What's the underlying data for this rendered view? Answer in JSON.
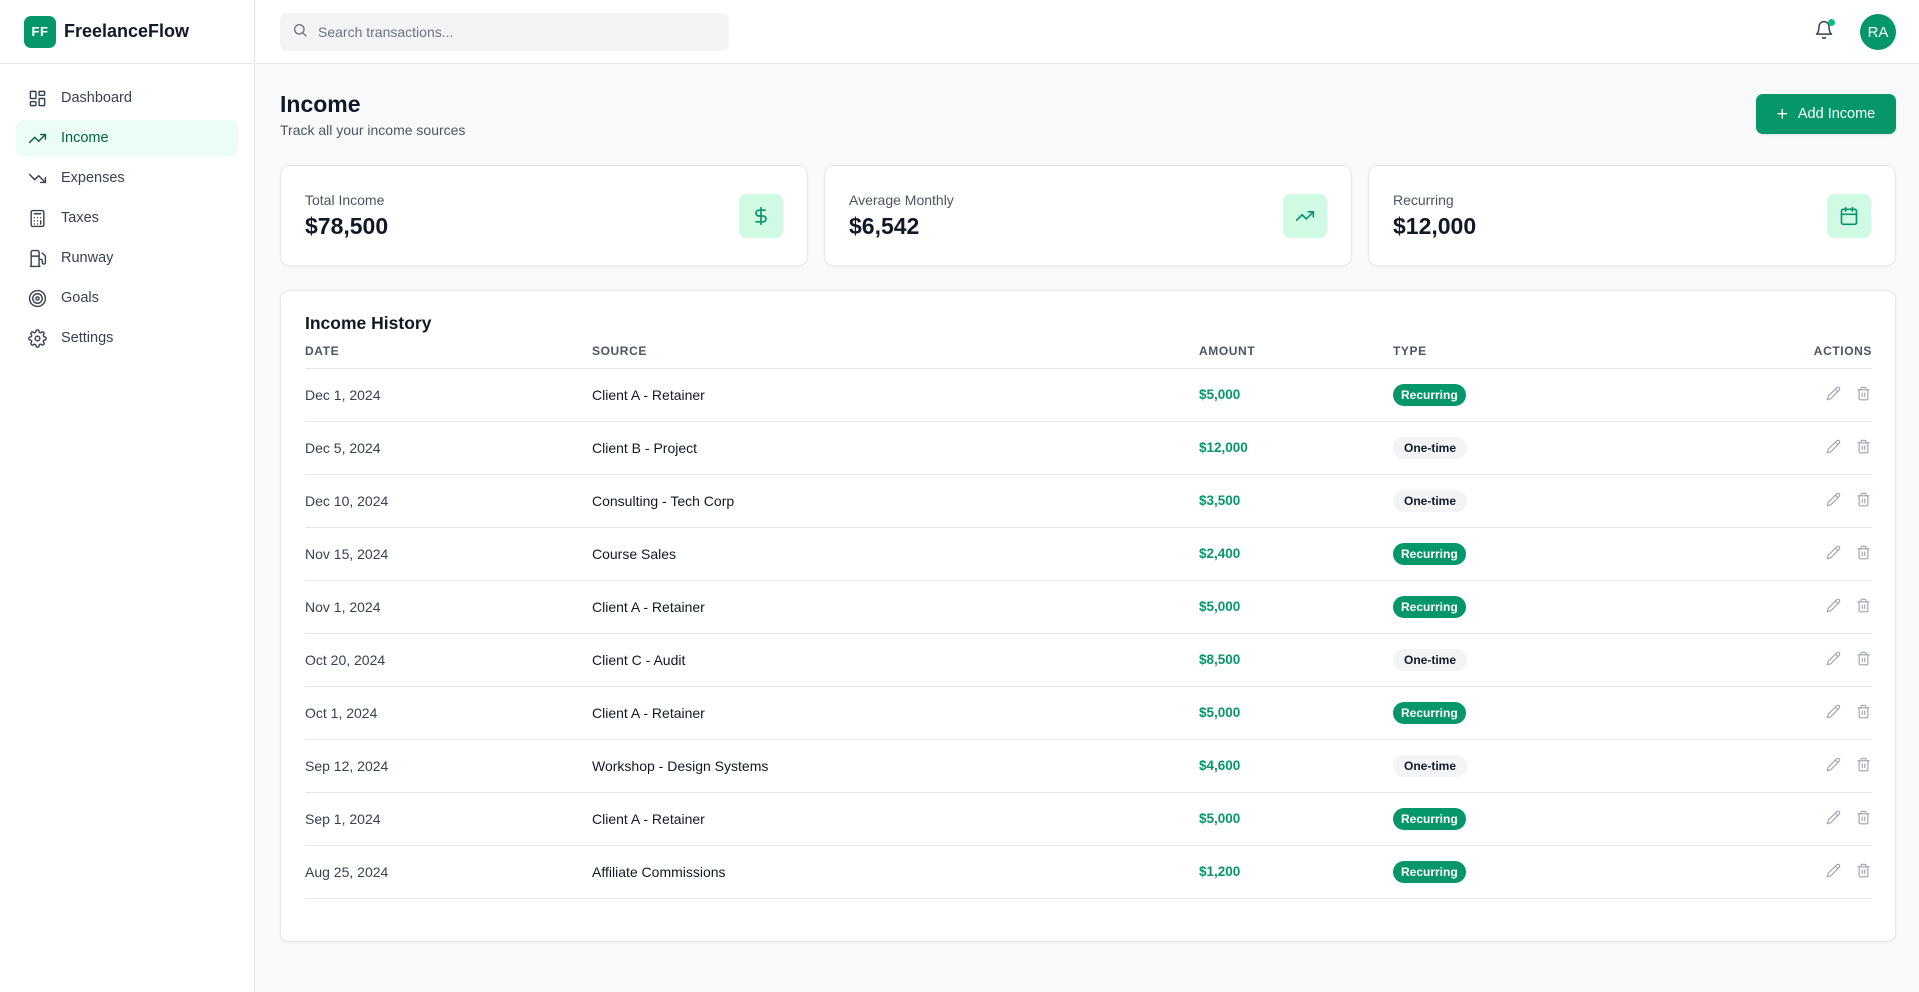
{
  "brand": {
    "logo": "FF",
    "name": "FreelanceFlow"
  },
  "sidebar": {
    "items": [
      {
        "label": "Dashboard",
        "icon": "dashboard-icon",
        "active": false
      },
      {
        "label": "Income",
        "icon": "trending-up-icon",
        "active": true
      },
      {
        "label": "Expenses",
        "icon": "trending-down-icon",
        "active": false
      },
      {
        "label": "Taxes",
        "icon": "calculator-icon",
        "active": false
      },
      {
        "label": "Runway",
        "icon": "fuel-icon",
        "active": false
      },
      {
        "label": "Goals",
        "icon": "target-icon",
        "active": false
      },
      {
        "label": "Settings",
        "icon": "gear-icon",
        "active": false
      }
    ]
  },
  "topbar": {
    "search_placeholder": "Search transactions...",
    "avatar_initials": "RA",
    "notification_dot": true
  },
  "page": {
    "title": "Income",
    "subtitle": "Track all your income sources",
    "add_button": "Add Income"
  },
  "stats": [
    {
      "label": "Total Income",
      "value": "$78,500",
      "icon": "dollar-icon"
    },
    {
      "label": "Average Monthly",
      "value": "$6,542",
      "icon": "trending-up-icon"
    },
    {
      "label": "Recurring",
      "value": "$12,000",
      "icon": "calendar-icon"
    }
  ],
  "history": {
    "title": "Income History",
    "columns": {
      "date": "Date",
      "source": "Source",
      "amount": "Amount",
      "type": "Type",
      "actions": "Actions"
    },
    "rows": [
      {
        "date": "Dec 1, 2024",
        "source": "Client A - Retainer",
        "amount": "$5,000",
        "type": "Recurring"
      },
      {
        "date": "Dec 5, 2024",
        "source": "Client B - Project",
        "amount": "$12,000",
        "type": "One-time"
      },
      {
        "date": "Dec 10, 2024",
        "source": "Consulting - Tech Corp",
        "amount": "$3,500",
        "type": "One-time"
      },
      {
        "date": "Nov 15, 2024",
        "source": "Course Sales",
        "amount": "$2,400",
        "type": "Recurring"
      },
      {
        "date": "Nov 1, 2024",
        "source": "Client A - Retainer",
        "amount": "$5,000",
        "type": "Recurring"
      },
      {
        "date": "Oct 20, 2024",
        "source": "Client C - Audit",
        "amount": "$8,500",
        "type": "One-time"
      },
      {
        "date": "Oct 1, 2024",
        "source": "Client A - Retainer",
        "amount": "$5,000",
        "type": "Recurring"
      },
      {
        "date": "Sep 12, 2024",
        "source": "Workshop - Design Systems",
        "amount": "$4,600",
        "type": "One-time"
      },
      {
        "date": "Sep 1, 2024",
        "source": "Client A - Retainer",
        "amount": "$5,000",
        "type": "Recurring"
      },
      {
        "date": "Aug 25, 2024",
        "source": "Affiliate Commissions",
        "amount": "$1,200",
        "type": "Recurring"
      }
    ]
  },
  "colors": {
    "accent": "#059669",
    "accent_light": "#d1fae5",
    "active_nav_bg": "#ecfdf5"
  }
}
